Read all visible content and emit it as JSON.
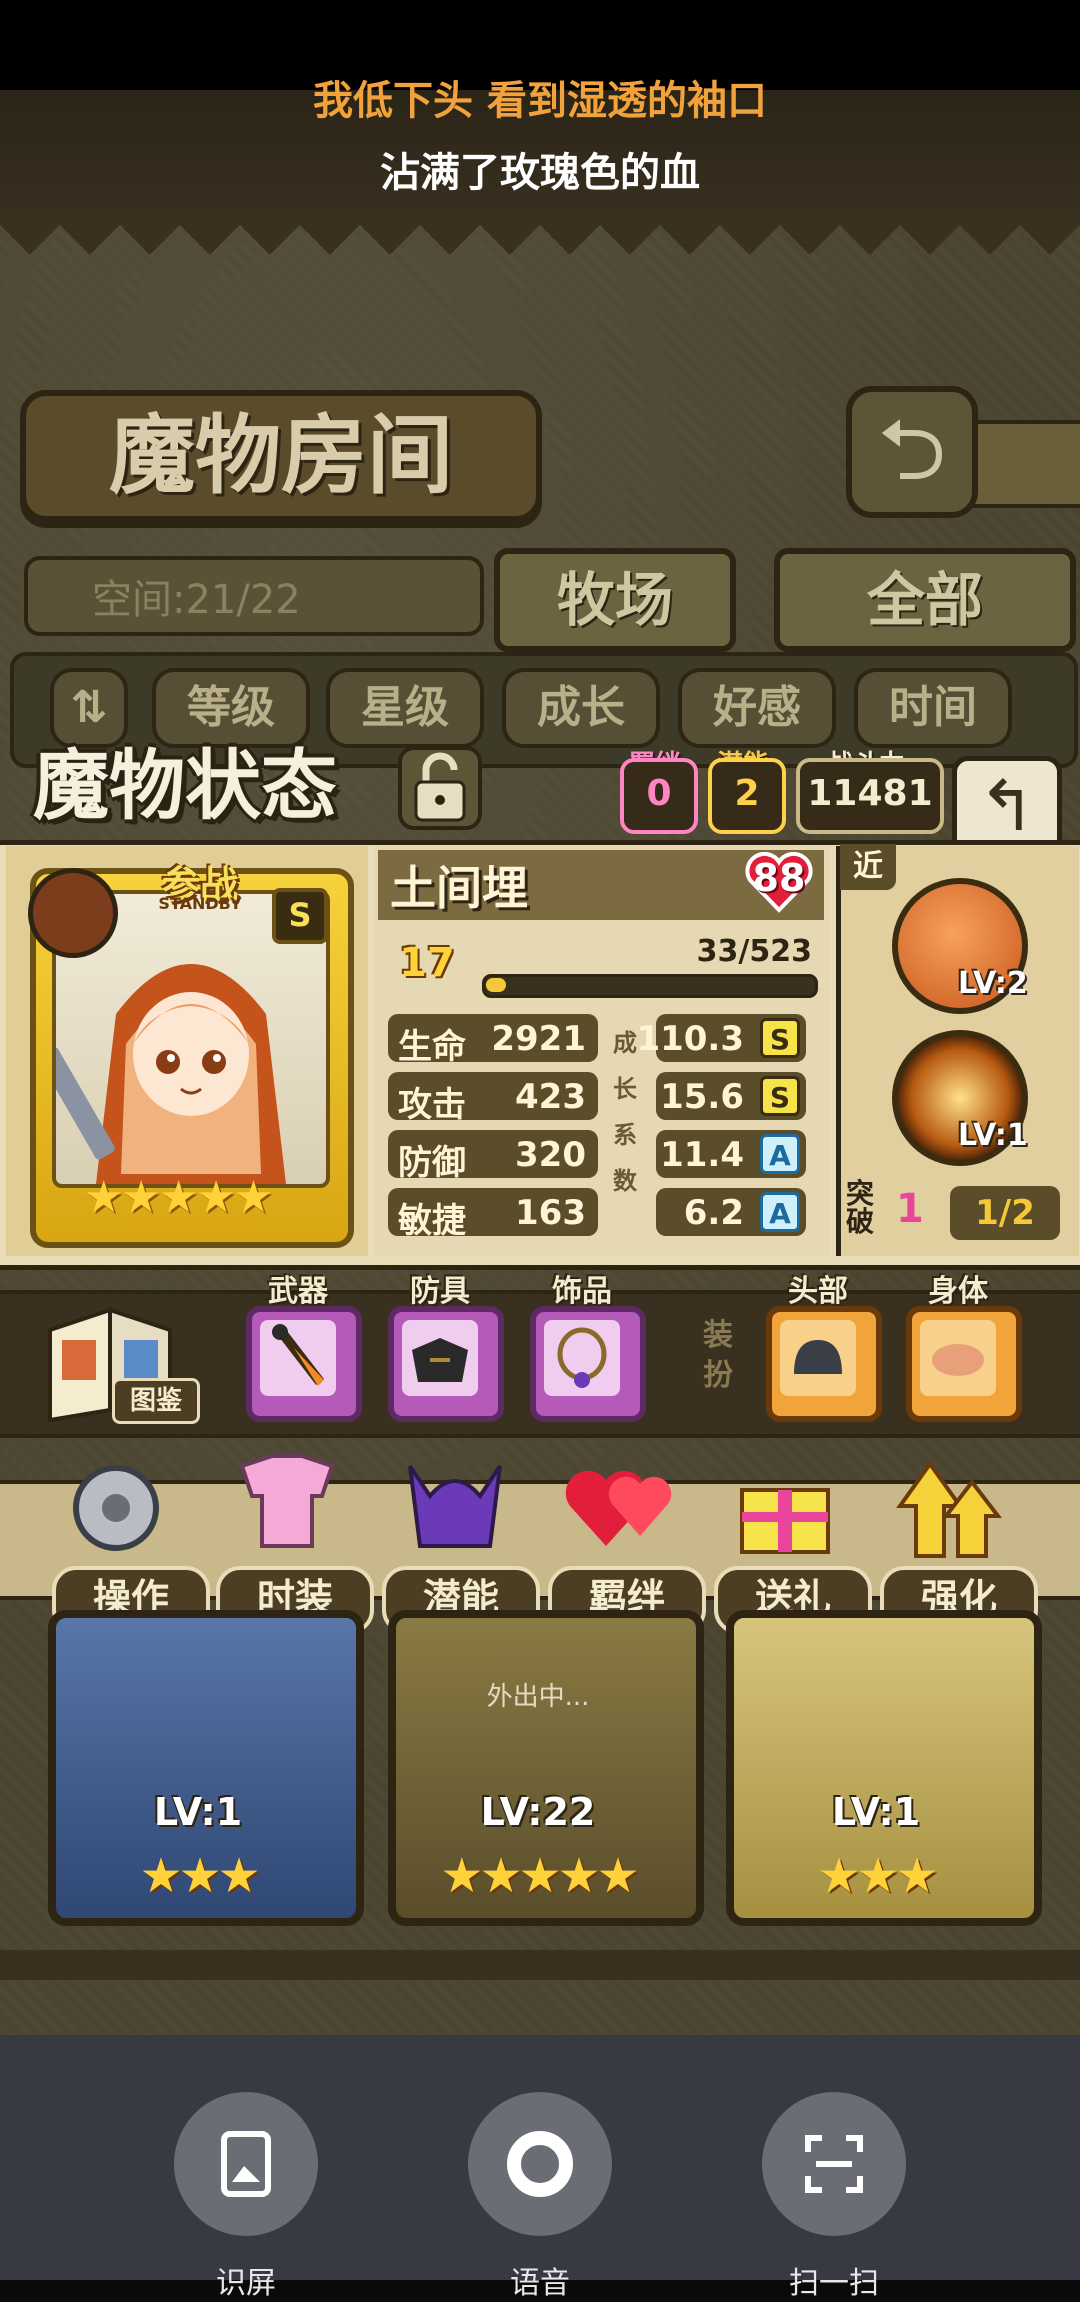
{
  "lyrics": {
    "line1": "我低下头 看到湿透的袖口",
    "line2": "沾满了玫瑰色的血"
  },
  "header": {
    "title": "魔物房间",
    "back_icon": "return-arrow-icon"
  },
  "tabs": {
    "space_label": "空间:21/22",
    "ranch": "牧场",
    "all": "全部"
  },
  "sort": {
    "buttons": [
      "等级",
      "星级",
      "成长",
      "好感",
      "时间"
    ]
  },
  "status": {
    "title": "魔物状态",
    "bond_label": "羁绊",
    "bond_value": "0",
    "potential_label": "潜能",
    "potential_value": "2",
    "power_label": "战斗力",
    "power_value": "11481"
  },
  "card": {
    "stand_label": "参战",
    "stand_sub": "STANDBY",
    "rank": "S",
    "stars": "★★★★★"
  },
  "monster": {
    "name": "土间埋",
    "affection": "88",
    "level": "17",
    "exp_text": "33/523",
    "exp_fraction": 0.063,
    "stats": [
      {
        "label": "生命",
        "value": "2921",
        "growth": "110.3",
        "grade": "S"
      },
      {
        "label": "攻击",
        "value": "423",
        "growth": "15.6",
        "grade": "S"
      },
      {
        "label": "防御",
        "value": "320",
        "growth": "11.4",
        "grade": "A"
      },
      {
        "label": "敏捷",
        "value": "163",
        "growth": "6.2",
        "grade": "A"
      }
    ],
    "growth_label": "成长系数"
  },
  "skills": {
    "range": "近",
    "skill1_lv": "LV:2",
    "skill2_lv": "LV:1",
    "break_label": "突破",
    "break_count": "1",
    "break_progress": "1/2"
  },
  "equipment": {
    "book_label": "图鉴",
    "weapon": "武器",
    "armor": "防具",
    "accessory": "饰品",
    "dress_label": "装扮",
    "head": "头部",
    "body": "身体"
  },
  "actions": [
    "操作",
    "时装",
    "潜能",
    "羁绊",
    "送礼",
    "强化"
  ],
  "monsters": [
    {
      "lv": "LV:1",
      "stars": "★★★"
    },
    {
      "lv": "LV:22",
      "stars": "★★★★★",
      "status": "外出中..."
    },
    {
      "lv": "LV:1",
      "stars": "★★★"
    }
  ],
  "sheet": {
    "btn1": "识屏",
    "btn2": "语音",
    "btn3": "扫一扫"
  }
}
